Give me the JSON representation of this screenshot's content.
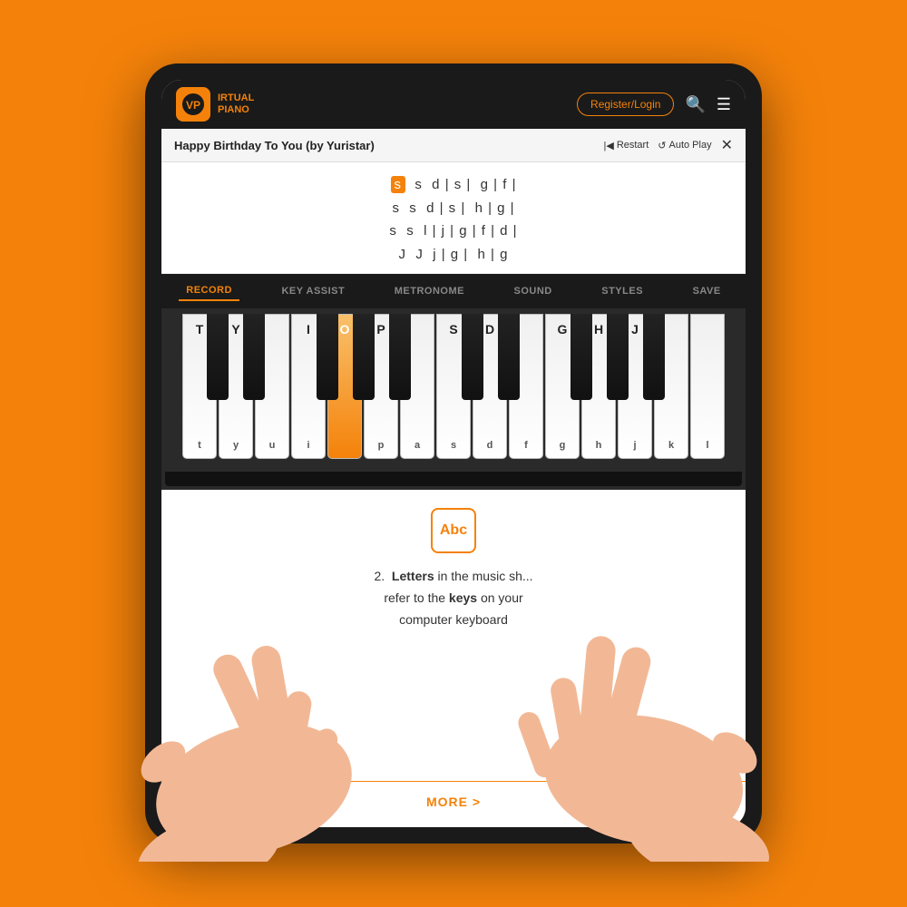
{
  "header": {
    "logo_line1": "IRTUAL",
    "logo_line2": "PIANO",
    "register_label": "Register/Login",
    "search_icon": "🔍",
    "menu_icon": "☰"
  },
  "song_bar": {
    "title": "Happy Birthday To You (by Yuristar)",
    "restart_label": "Restart",
    "autoplay_label": "Auto Play",
    "close_icon": "✕"
  },
  "sheet": {
    "lines": [
      "s  s  d | s  |  g  | f  |",
      "s  s  d | s  |  h  | g  |",
      "s  s  l | j  | g  | f  | d  |",
      "J  J  j | g  |  h  | g"
    ],
    "highlighted_char": "s"
  },
  "toolbar": {
    "items": [
      {
        "label": "RECORD",
        "active": true
      },
      {
        "label": "KEY ASSIST",
        "active": false
      },
      {
        "label": "METRONOME",
        "active": false
      },
      {
        "label": "SOUND",
        "active": false
      },
      {
        "label": "STYLES",
        "active": false
      },
      {
        "label": "SAVE",
        "active": false
      }
    ]
  },
  "piano": {
    "white_keys": [
      {
        "label": "T",
        "upper": true,
        "lower": "t"
      },
      {
        "label": "Y",
        "upper": true,
        "lower": "y"
      },
      {
        "label": "",
        "upper": false,
        "lower": "u"
      },
      {
        "label": "I",
        "upper": true,
        "lower": "i"
      },
      {
        "label": "O",
        "upper": true,
        "lower": "",
        "pressed": true
      },
      {
        "label": "P",
        "upper": true,
        "lower": "p"
      },
      {
        "label": "",
        "upper": false,
        "lower": "a"
      },
      {
        "label": "S",
        "upper": true,
        "lower": "s"
      },
      {
        "label": "D",
        "upper": true,
        "lower": "d"
      },
      {
        "label": "",
        "upper": false,
        "lower": "f"
      },
      {
        "label": "G",
        "upper": true,
        "lower": "g"
      },
      {
        "label": "H",
        "upper": true,
        "lower": "h"
      },
      {
        "label": "J",
        "upper": true,
        "lower": "j"
      },
      {
        "label": "",
        "upper": false,
        "lower": "k"
      },
      {
        "label": "",
        "upper": false,
        "lower": "l"
      }
    ]
  },
  "info": {
    "abc_label": "Abc",
    "step_number": "2.",
    "text_line1": "Letters in the music sh...",
    "text_line2": "refer to the keys on your",
    "text_line3": "computer keyboard",
    "more_label": "MORE >"
  }
}
